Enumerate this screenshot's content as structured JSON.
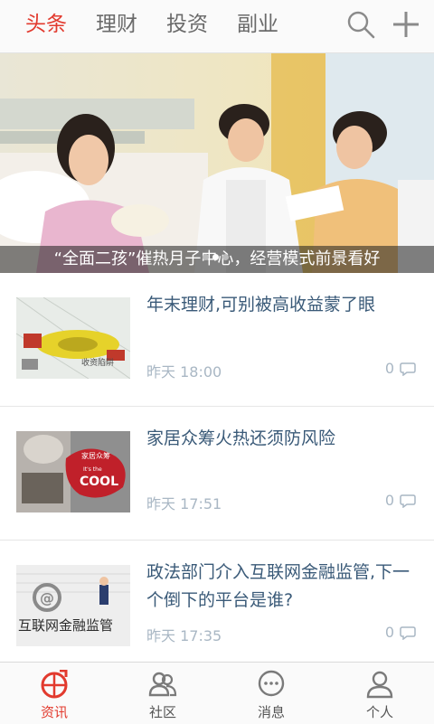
{
  "top_tabs": [
    {
      "label": "头条",
      "active": true
    },
    {
      "label": "理财",
      "active": false
    },
    {
      "label": "投资",
      "active": false
    },
    {
      "label": "副业",
      "active": false
    }
  ],
  "icons": {
    "search": "search-icon",
    "add": "plus-icon"
  },
  "accent_color": "#e23a2e",
  "banner": {
    "caption": "“全面二孩”催热月子中心，经营模式前景看好",
    "slide_count": 3,
    "active_slide": 2
  },
  "news": [
    {
      "title": "年末理财,可别被高收益蒙了眼",
      "time": "昨天 18:00",
      "comments": "0",
      "thumb_text": "收资陷阱"
    },
    {
      "title": "家居众筹火热还须防风险",
      "time": "昨天 17:51",
      "comments": "0",
      "thumb_text": "家居众筹",
      "thumb_text2": "COOL",
      "thumb_text3": "It's the"
    },
    {
      "title": "政法部门介入互联网金融监管,下一个倒下的平台是谁?",
      "time": "昨天 17:35",
      "comments": "0",
      "thumb_text": "互联网金融监管"
    }
  ],
  "bottom_nav": [
    {
      "label": "资讯",
      "icon": "globe-arrow-icon",
      "active": true
    },
    {
      "label": "社区",
      "icon": "people-icon",
      "active": false
    },
    {
      "label": "消息",
      "icon": "chat-bubble-icon",
      "active": false
    },
    {
      "label": "个人",
      "icon": "person-icon",
      "active": false
    }
  ]
}
